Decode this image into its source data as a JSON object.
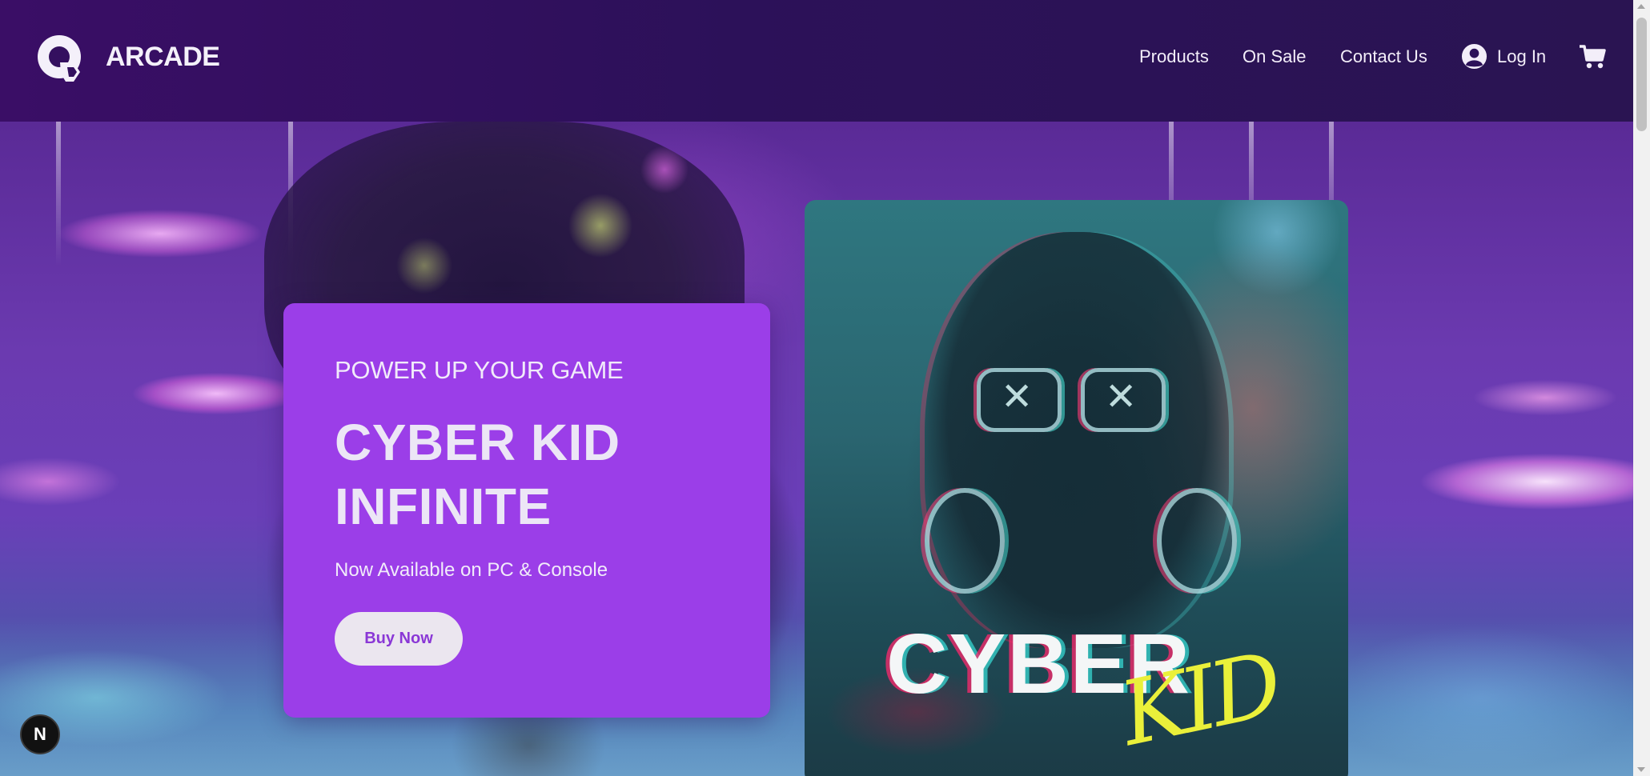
{
  "header": {
    "brand": "ARCADE",
    "nav": {
      "products": "Products",
      "on_sale": "On Sale",
      "contact": "Contact Us",
      "login": "Log In"
    },
    "icons": [
      "arcade-logo-icon",
      "user-circle-icon",
      "shopping-cart-icon"
    ]
  },
  "hero": {
    "eyebrow": "POWER UP YOUR GAME",
    "title_line1": "CYBER KID",
    "title_line2": "INFINITE",
    "subtitle": "Now Available on PC & Console",
    "cta_label": "Buy Now",
    "cover_title": "CYBER",
    "cover_subtitle": "KID"
  },
  "badge": {
    "label": "N"
  },
  "colors": {
    "header_bg": "#2c1159",
    "promo_bg": "#9b3ee8",
    "button_bg": "#ebe6ef",
    "button_text": "#8a37d6",
    "cover_accent": "#eaf03a"
  }
}
